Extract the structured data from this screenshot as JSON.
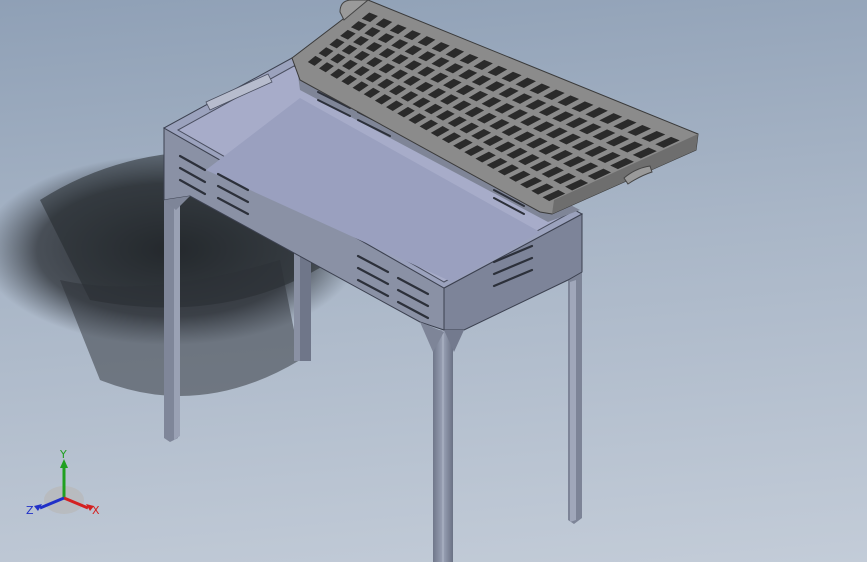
{
  "viewport": {
    "model": "bbq-grill-assembly",
    "background_top": "#8fa0b6",
    "background_bottom": "#c3ccd8",
    "body_color": "#8a92a8",
    "grate_color": "#8c8c8c"
  },
  "triad": {
    "x_label": "X",
    "y_label": "Y",
    "z_label": "Z",
    "x_color": "#d42020",
    "y_color": "#20a020",
    "z_color": "#2030c8"
  }
}
